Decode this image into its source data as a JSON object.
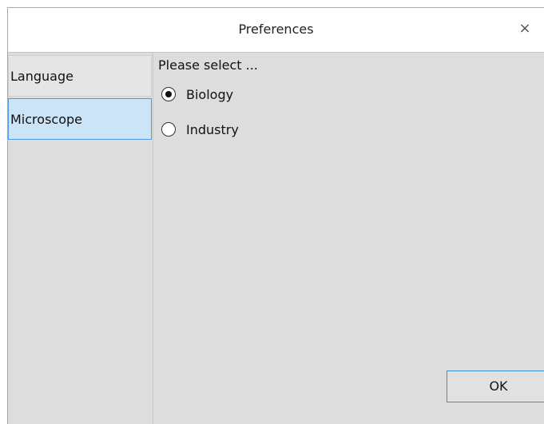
{
  "window": {
    "title": "Preferences",
    "close_glyph": "×"
  },
  "sidebar": {
    "items": [
      {
        "label": "Language",
        "selected": false
      },
      {
        "label": "Microscope",
        "selected": true
      }
    ]
  },
  "microscope": {
    "prompt": "Please select ...",
    "options": [
      {
        "label": "Biology",
        "checked": true
      },
      {
        "label": "Industry",
        "checked": false
      }
    ]
  },
  "footer": {
    "ok_label": "OK"
  },
  "colors": {
    "selected_item_bg": "#cbe4f8",
    "selected_item_border": "#4e9ae6",
    "focus_border": "#3c8ee0",
    "panel_bg": "#dddddd"
  }
}
